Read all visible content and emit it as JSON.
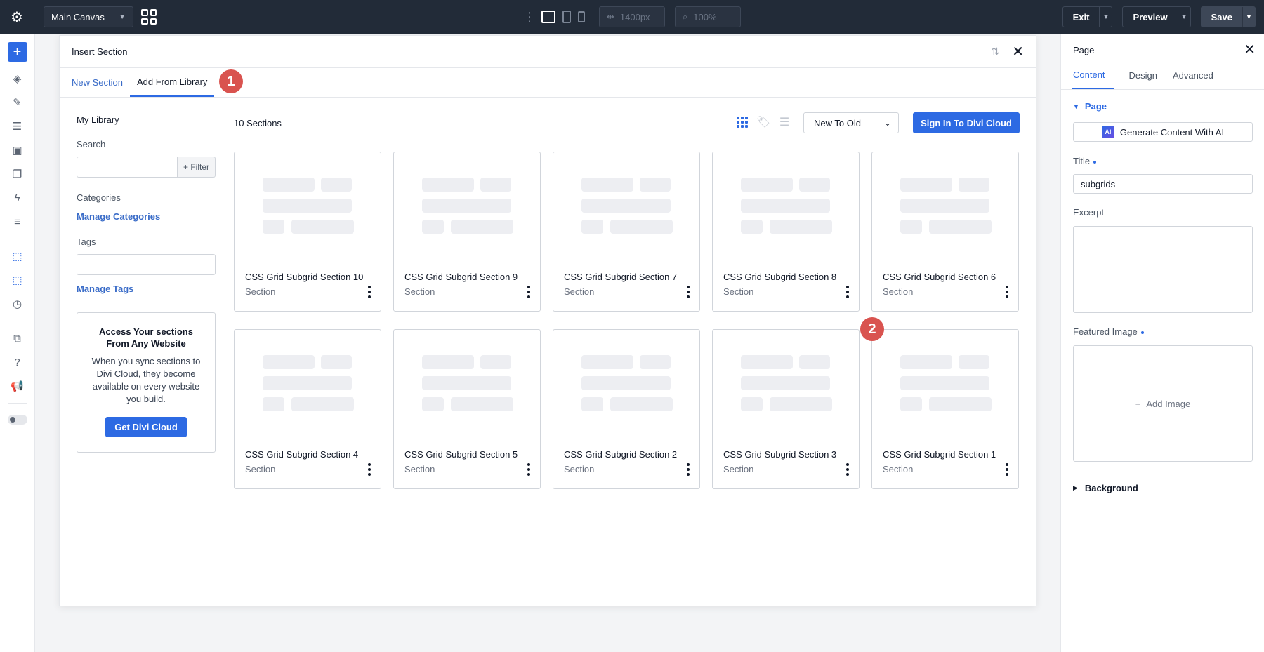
{
  "topbar": {
    "canvas_label": "Main Canvas",
    "width_value": "1400px",
    "zoom_value": "100%",
    "exit_label": "Exit",
    "preview_label": "Preview",
    "save_label": "Save"
  },
  "modal": {
    "title": "Insert Section",
    "tabs": [
      {
        "label": "New Section"
      },
      {
        "label": "Add From Library"
      }
    ],
    "badges": [
      "1",
      "2"
    ]
  },
  "library": {
    "title": "My Library",
    "search_label": "Search",
    "filter_label": "+ Filter",
    "categories_label": "Categories",
    "manage_categories": "Manage Categories",
    "tags_label": "Tags",
    "manage_tags": "Manage Tags",
    "cloud_title": "Access Your sections From Any Website",
    "cloud_text": "When you sync sections to Divi Cloud, they become available on every website you build.",
    "cloud_button": "Get Divi Cloud"
  },
  "grid": {
    "count_label": "10 Sections",
    "sort_value": "New To Old",
    "signin_label": "Sign In To Divi Cloud",
    "cards": [
      {
        "title": "CSS Grid Subgrid Section 10",
        "type": "Section"
      },
      {
        "title": "CSS Grid Subgrid Section 9",
        "type": "Section"
      },
      {
        "title": "CSS Grid Subgrid Section 7",
        "type": "Section"
      },
      {
        "title": "CSS Grid Subgrid Section 8",
        "type": "Section"
      },
      {
        "title": "CSS Grid Subgrid Section 6",
        "type": "Section"
      },
      {
        "title": "CSS Grid Subgrid Section 4",
        "type": "Section"
      },
      {
        "title": "CSS Grid Subgrid Section 5",
        "type": "Section"
      },
      {
        "title": "CSS Grid Subgrid Section 2",
        "type": "Section"
      },
      {
        "title": "CSS Grid Subgrid Section 3",
        "type": "Section"
      },
      {
        "title": "CSS Grid Subgrid Section 1",
        "type": "Section"
      }
    ]
  },
  "panel": {
    "title": "Page",
    "tabs": [
      {
        "label": "Content"
      },
      {
        "label": "Design"
      },
      {
        "label": "Advanced"
      }
    ],
    "section_label": "Page",
    "ai_badge": "AI",
    "ai_button": "Generate Content With AI",
    "title_label": "Title",
    "title_value": "subgrids",
    "excerpt_label": "Excerpt",
    "featured_label": "Featured Image",
    "add_image": "Add Image",
    "background_label": "Background"
  },
  "colors": {
    "accent": "#2d6ae3",
    "topbar": "#222b38",
    "badge": "#d9534f"
  }
}
